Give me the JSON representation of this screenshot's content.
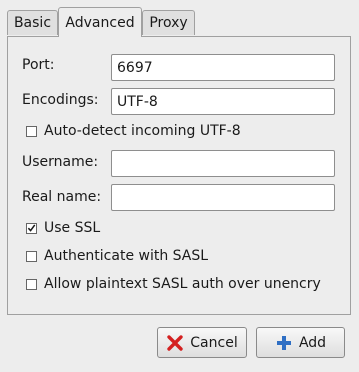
{
  "tabs": [
    {
      "label": "Basic"
    },
    {
      "label": "Advanced"
    },
    {
      "label": "Proxy"
    }
  ],
  "form": {
    "port": {
      "label": "Port:",
      "value": "6697"
    },
    "encodings": {
      "label": "Encodings:",
      "value": "UTF-8"
    },
    "auto_detect": {
      "label": "Auto-detect incoming UTF-8",
      "checked": false
    },
    "username": {
      "label": "Username:",
      "value": ""
    },
    "real_name": {
      "label": "Real name:",
      "value": ""
    },
    "use_ssl": {
      "label": "Use SSL",
      "checked": true
    },
    "auth_sasl": {
      "label": "Authenticate with SASL",
      "checked": false
    },
    "plaintext_sasl": {
      "label": "Allow plaintext SASL auth over unencry",
      "checked": false
    }
  },
  "buttons": {
    "cancel": {
      "label": "Cancel",
      "icon": "red-x-icon"
    },
    "add": {
      "label": "Add",
      "icon": "blue-plus-icon"
    }
  },
  "colors": {
    "cancel_icon": "#d42020",
    "add_icon": "#2f6fc4"
  }
}
